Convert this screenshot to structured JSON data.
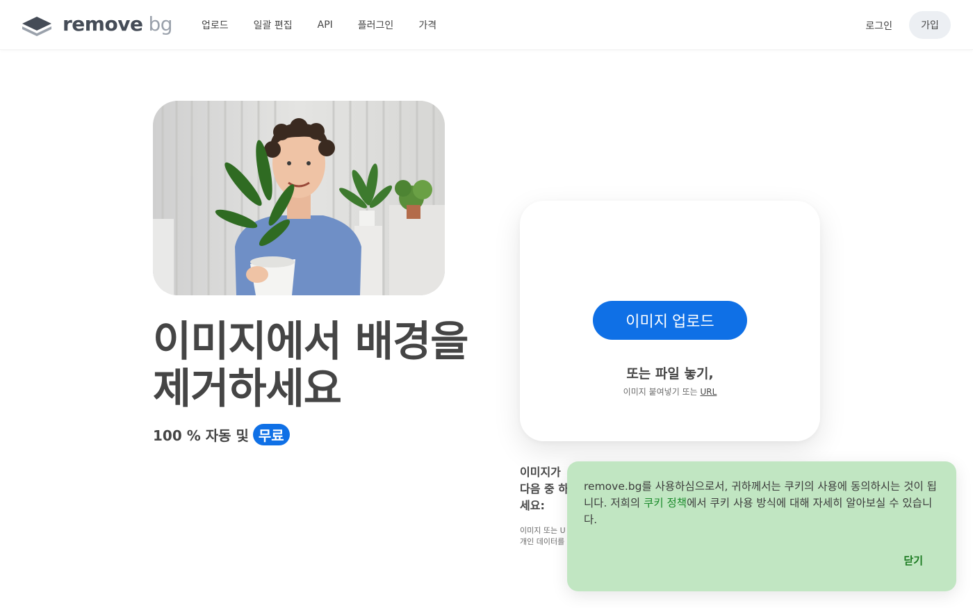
{
  "brand": {
    "name": "remove",
    "suffix": "bg"
  },
  "nav": {
    "items": [
      {
        "label": "업로드"
      },
      {
        "label": "일괄 편집"
      },
      {
        "label": "API"
      },
      {
        "label": "플러그인"
      },
      {
        "label": "가격"
      }
    ],
    "login_label": "로그인",
    "signup_label": "가입"
  },
  "hero": {
    "title_line1": "이미지에서 배경을",
    "title_line2": "제거하세요",
    "subtitle": "100 % 자동 및",
    "badge": "무료"
  },
  "upload": {
    "button_label": "이미지 업로드",
    "drop_text": "또는 파일 놓기,",
    "paste_text": "이미지 붙여넣기 또는",
    "url_label": "URL"
  },
  "samples": {
    "title_line1": "이미지가",
    "title_line2": "다음 중 하",
    "title_line3": "세요:",
    "note_line1": "이미지 또는 U",
    "note_line2": "개인 데이터를"
  },
  "cookie": {
    "text_before": "remove.bg를 사용하심으로서, 귀하께서는 쿠키의 사용에 동의하시는 것이 됩니다. 저희의 ",
    "policy_link": "쿠키 정책",
    "text_after": "에서 쿠키 사용 방식에 대해 자세히 알아보실 수 있습니다.",
    "close_label": "닫기"
  },
  "colors": {
    "primary": "#0f70e6",
    "text": "#454545",
    "cookie_bg": "#c1e6c2",
    "cookie_link": "#1a8a2a"
  }
}
